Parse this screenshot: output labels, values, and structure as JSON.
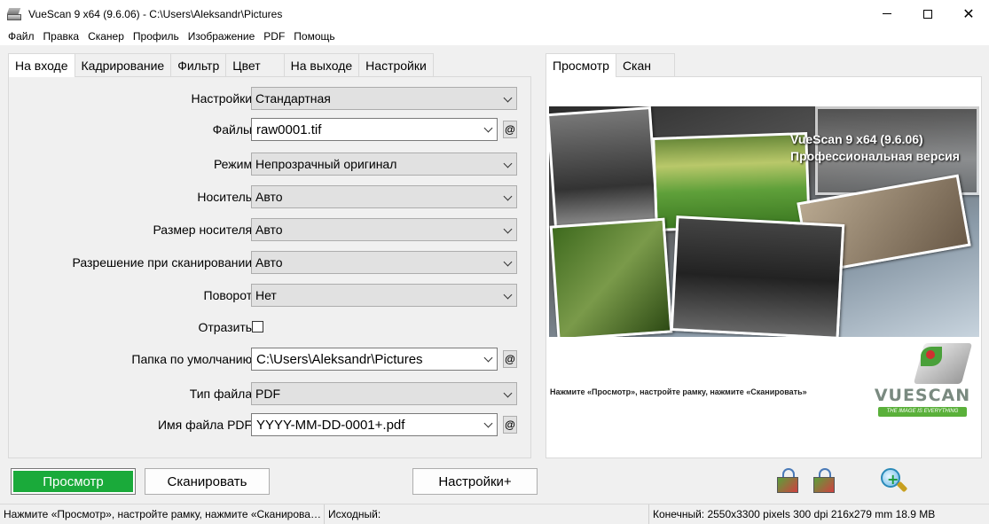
{
  "window": {
    "title": "VueScan 9 x64 (9.6.06) - C:\\Users\\Aleksandr\\Pictures",
    "close_glyph": "✕"
  },
  "menu": [
    "Файл",
    "Правка",
    "Сканер",
    "Профиль",
    "Изображение",
    "PDF",
    "Помощь"
  ],
  "left_tabs": [
    {
      "label": "На входе",
      "active": true
    },
    {
      "label": "Кадрирование"
    },
    {
      "label": "Фильтр"
    },
    {
      "label": "Цвет"
    },
    {
      "label": "На выходе"
    },
    {
      "label": "Настройки"
    }
  ],
  "form": {
    "settings": {
      "label": "Настройки:",
      "value": "Стандартная"
    },
    "files": {
      "label": "Файлы:",
      "value": "raw0001.tif"
    },
    "mode": {
      "label": "Режим:",
      "value": "Непрозрачный оригинал"
    },
    "media": {
      "label": "Носитель:",
      "value": "Авто"
    },
    "media_size": {
      "label": "Размер носителя:",
      "value": "Авто"
    },
    "resolution": {
      "label": "Разрешение при сканировании:",
      "value": "Авто"
    },
    "rotation": {
      "label": "Поворот:",
      "value": "Нет"
    },
    "mirror": {
      "label": "Отразить:",
      "checked": false
    },
    "default_folder": {
      "label": "Папка по умолчанию:",
      "value": "C:\\Users\\Aleksandr\\Pictures"
    },
    "file_type": {
      "label": "Тип файла:",
      "value": "PDF"
    },
    "pdf_name": {
      "label": "Имя файла PDF:",
      "value": "YYYY-MM-DD-0001+.pdf"
    },
    "at_symbol": "@"
  },
  "buttons": {
    "preview": "Просмотр",
    "scan": "Сканировать",
    "more_options": "Настройки+"
  },
  "right_tabs": [
    {
      "label": "Просмотр",
      "active": true
    },
    {
      "label": "Скан"
    }
  ],
  "preview": {
    "title_line1": "VueScan 9 x64 (9.6.06)",
    "title_line2": "Профессиональная версия",
    "hint": "Нажмите «Просмотр», настройте рамку, нажмите «Сканировать»",
    "logo_word": "VUESCAN",
    "logo_tag": "THE IMAGE IS EVERYTHING"
  },
  "status": {
    "left": "Нажмите «Просмотр», настройте рамку, нажмите «Сканирова…",
    "source": "Исходный:",
    "output": "Конечный: 2550x3300 pixels 300 dpi 216x279 mm 18.9 MB"
  }
}
